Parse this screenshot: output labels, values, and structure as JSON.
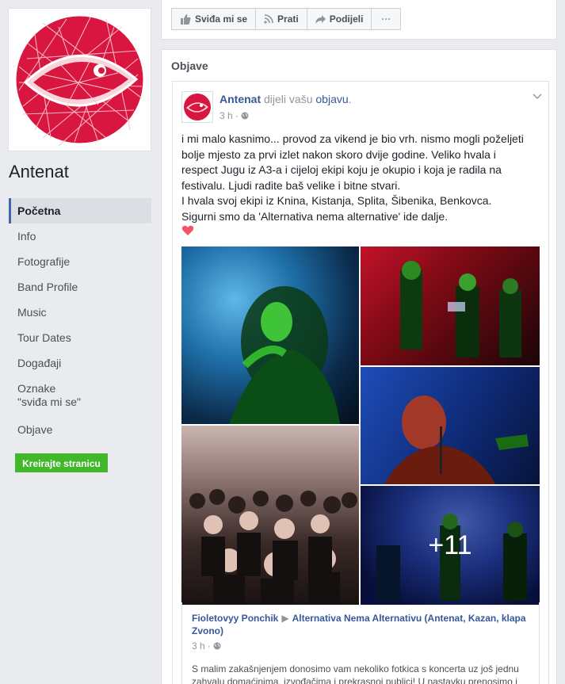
{
  "page": {
    "name": "Antenat"
  },
  "nav": {
    "items": [
      {
        "label": "Početna"
      },
      {
        "label": "Info"
      },
      {
        "label": "Fotografije"
      },
      {
        "label": "Band Profile"
      },
      {
        "label": "Music"
      },
      {
        "label": "Tour Dates"
      },
      {
        "label": "Događaji"
      },
      {
        "label": "Oznake\n\"sviđa mi se\""
      },
      {
        "label": "Objave"
      }
    ],
    "create_page": "Kreirajte stranicu"
  },
  "actions": {
    "like": "Sviđa mi se",
    "follow": "Prati",
    "share": "Podijeli",
    "more": "···"
  },
  "posts": {
    "section_title": "Objave",
    "post": {
      "author": "Antenat",
      "verb": "dijeli vašu",
      "object": "objavu",
      "time": "3 h",
      "text_lines": [
        "i mi malo kasnimo... provod za vikend je bio vrh. nismo mogli poželjeti",
        "bolje mjesto za prvi izlet nakon skoro dvije godine. Veliko hvala i",
        "respect Jugu iz A3-a i cijeloj ekipi koju je okupio i koja je radila na",
        "festivalu. Ljudi radite baš velike i bitne stvari.",
        "I hvala svoj ekipi iz Knina, Kistanja, Splita, Šibenika, Benkovca.",
        "Sigurni smo da 'Alternativa nema alternative' ide dalje."
      ],
      "extra_photos": "+11",
      "shared": {
        "author": "Fioletovyy Ponchik",
        "target": "Alternativa Nema Alternativu (Antenat, Kazan, klapa Zvono)",
        "time": "3 h",
        "text": "S malim zakašnjenjem donosimo vam nekoliko fotkica s koncerta uz još jednu zahvalu domaćinima, izvođačima i prekrasnoj publici! U nastavku prenosimo i"
      }
    }
  },
  "colors": {
    "brand_blue": "#4267b2",
    "link": "#365899",
    "green_button": "#42b72a",
    "logo_red": "#d9163f"
  }
}
